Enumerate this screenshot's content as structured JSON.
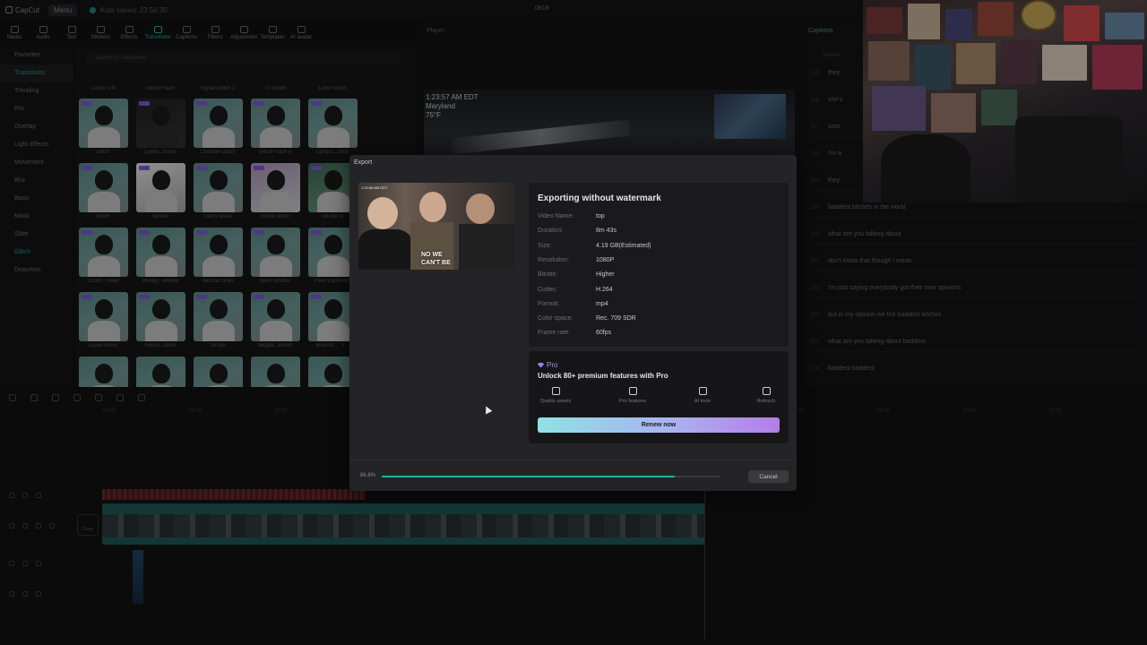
{
  "topbar": {
    "app_name": "CapCut",
    "menu_label": "Menu",
    "autosave_text": "Auto saved: 23:56:30",
    "project_title": "0818"
  },
  "toolbar": {
    "items": [
      {
        "label": "Media",
        "icon": "media-icon"
      },
      {
        "label": "Audio",
        "icon": "audio-icon"
      },
      {
        "label": "Text",
        "icon": "text-icon"
      },
      {
        "label": "Stickers",
        "icon": "stickers-icon"
      },
      {
        "label": "Effects",
        "icon": "effects-icon"
      },
      {
        "label": "Transitions",
        "icon": "transitions-icon",
        "active": true
      },
      {
        "label": "Captions",
        "icon": "captions-icon"
      },
      {
        "label": "Filters",
        "icon": "filters-icon"
      },
      {
        "label": "Adjustment",
        "icon": "adjustment-icon"
      },
      {
        "label": "Templates",
        "icon": "templates-icon"
      },
      {
        "label": "AI avatar",
        "icon": "ai-avatar-icon"
      }
    ]
  },
  "left_nav": {
    "items": [
      "Favorites",
      "Transitions",
      "Trending",
      "Pro",
      "Overlay",
      "Light Effects",
      "Movement",
      "Blur",
      "Basic",
      "Mask",
      "Slide",
      "Glitch",
      "Distortion"
    ]
  },
  "effects_panel": {
    "search_placeholder": "Search for transitions",
    "top_labels": [
      "Comic Glit",
      "Glitch Flash",
      "Signal Glitch 2",
      "TV Glitch",
      "Color Glitch"
    ],
    "rows": [
      [
        "Glitch",
        "Cyber...tches",
        "Channel Glitch",
        "Glitch Flash II",
        "Compu...ction"
      ],
      [
        "Glitch",
        "Strobe",
        "Glitch Wave",
        "Black Glitch",
        "Strobe III"
      ],
      [
        "Count...rewal",
        "Hologr...ARMal",
        "Vertical Lines",
        "Neon Shutter",
        "Pixel Explosion"
      ],
      [
        "Liquid Glitch",
        "Hount...sition",
        "Strobe",
        "Negati...action",
        "Monoth... Tr..."
      ]
    ]
  },
  "player": {
    "title": "Player",
    "overlay_time": "1:23:57 AM EDT",
    "overlay_location": "Maryland",
    "overlay_temp": "75°F"
  },
  "captions": {
    "title": "Captions",
    "search_placeholder": "Search",
    "rows": [
      {
        "num": "215",
        "text": "they"
      },
      {
        "num": "216",
        "text": "she's"
      },
      {
        "num": "217",
        "text": "som"
      },
      {
        "num": "218",
        "text": "I'm a"
      },
      {
        "num": "219",
        "text": "they"
      },
      {
        "num": "220",
        "text": "baddest bitches in the world"
      },
      {
        "num": "221",
        "text": "what are you talking about"
      },
      {
        "num": "222",
        "text": "don't know that though I mean"
      },
      {
        "num": "223",
        "text": "I'm just saying everybody got their own opinions"
      },
      {
        "num": "224",
        "text": "but in my opinion we the baddest bitches"
      },
      {
        "num": "225",
        "text": "what are you talking about baddest"
      },
      {
        "num": "226",
        "text": "baddest baddest"
      }
    ]
  },
  "timeline": {
    "cover_label": "Cover",
    "ruler": [
      "00:00",
      "01:00",
      "02:00",
      "03:00",
      "04:00",
      "05:00",
      "06:00",
      "07:00",
      "08:00",
      "09:00",
      "10:00",
      "11:00"
    ]
  },
  "export_dialog": {
    "title": "Export",
    "thumb_caption_line1": "NO WE",
    "thumb_caption_line2": "CAN'T BE",
    "thumb_small_text": "1:23:56 AM EDT",
    "heading": "Exporting without watermark",
    "info": [
      {
        "key": "Video Name:",
        "value": "top"
      },
      {
        "key": "Duration:",
        "value": "8m 43s"
      },
      {
        "key": "Size:",
        "value": "4.19 GB(Estimated)"
      },
      {
        "key": "Resolution:",
        "value": "1080P"
      },
      {
        "key": "Bitrate:",
        "value": "Higher"
      },
      {
        "key": "Codec:",
        "value": "H.264"
      },
      {
        "key": "Format:",
        "value": "mp4"
      },
      {
        "key": "Color space:",
        "value": "Rec. 709 SDR"
      },
      {
        "key": "Frame rate:",
        "value": "60fps"
      }
    ],
    "pro": {
      "badge": "Pro",
      "unlock_text": "Unlock 80+ premium features with Pro",
      "features": [
        {
          "label": "Quality assets",
          "icon": "quality-assets-icon"
        },
        {
          "label": "Pro features",
          "icon": "pro-features-icon"
        },
        {
          "label": "AI tools",
          "icon": "ai-tools-icon"
        },
        {
          "label": "Retouch",
          "icon": "retouch-icon"
        }
      ],
      "renew_label": "Renew now"
    },
    "progress_text": "86.6%",
    "progress_value": 0.866,
    "cancel_label": "Cancel"
  },
  "colors": {
    "accent": "#22b3a6",
    "pro_purple": "#a88cf2"
  }
}
